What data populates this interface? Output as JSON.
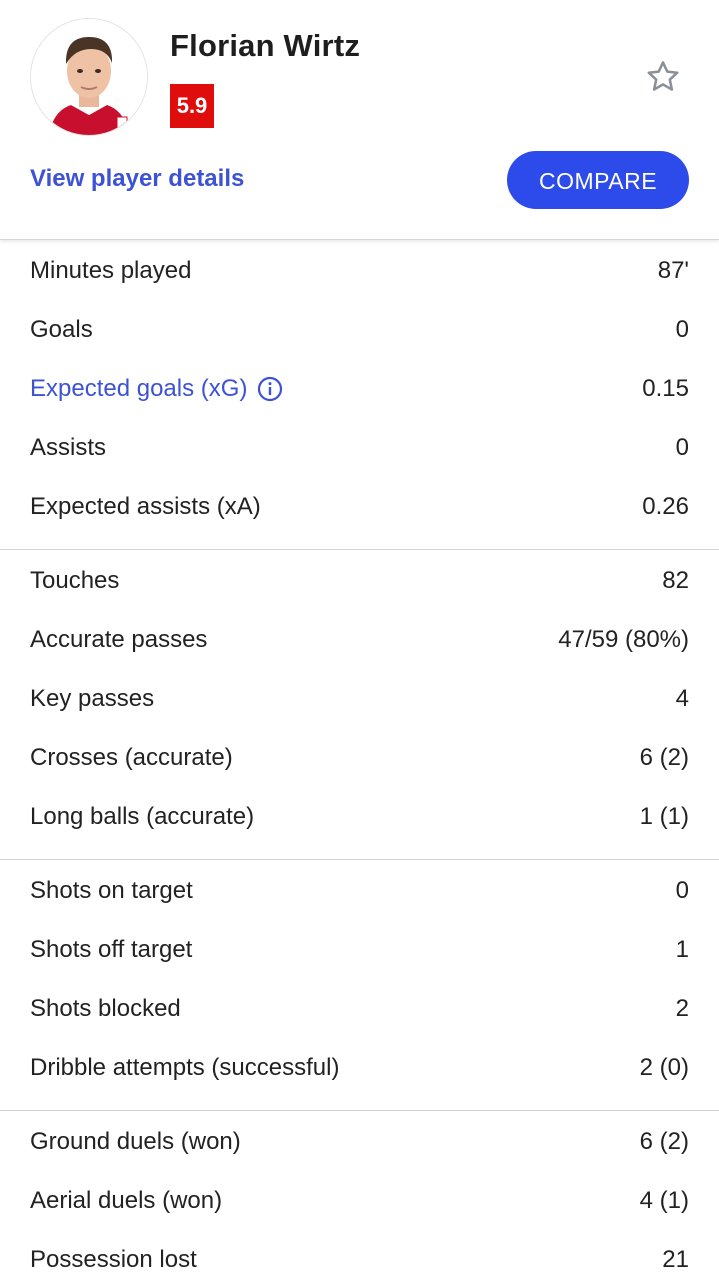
{
  "player": {
    "name": "Florian Wirtz",
    "rating": "5.9",
    "rating_color": "#e00d0d",
    "avatar_icon": "player-photo",
    "favorite_icon": "star-outline-icon",
    "details_link": "View player details",
    "compare_label": "COMPARE"
  },
  "colors": {
    "accent": "#3d52d5",
    "button": "#2d4bea"
  },
  "groups": [
    {
      "rows": [
        {
          "label": "Minutes played",
          "value": "87'"
        },
        {
          "label": "Goals",
          "value": "0"
        },
        {
          "label": "Expected goals (xG)",
          "value": "0.15",
          "info_icon": "info-icon"
        },
        {
          "label": "Assists",
          "value": "0"
        },
        {
          "label": "Expected assists (xA)",
          "value": "0.26"
        }
      ]
    },
    {
      "rows": [
        {
          "label": "Touches",
          "value": "82"
        },
        {
          "label": "Accurate passes",
          "value": "47/59 (80%)"
        },
        {
          "label": "Key passes",
          "value": "4"
        },
        {
          "label": "Crosses (accurate)",
          "value": "6 (2)"
        },
        {
          "label": "Long balls (accurate)",
          "value": "1 (1)"
        }
      ]
    },
    {
      "rows": [
        {
          "label": "Shots on target",
          "value": "0"
        },
        {
          "label": "Shots off target",
          "value": "1"
        },
        {
          "label": "Shots blocked",
          "value": "2"
        },
        {
          "label": "Dribble attempts (successful)",
          "value": "2 (0)"
        }
      ]
    },
    {
      "rows": [
        {
          "label": "Ground duels (won)",
          "value": "6 (2)"
        },
        {
          "label": "Aerial duels (won)",
          "value": "4 (1)"
        },
        {
          "label": "Possession lost",
          "value": "21"
        }
      ]
    }
  ]
}
